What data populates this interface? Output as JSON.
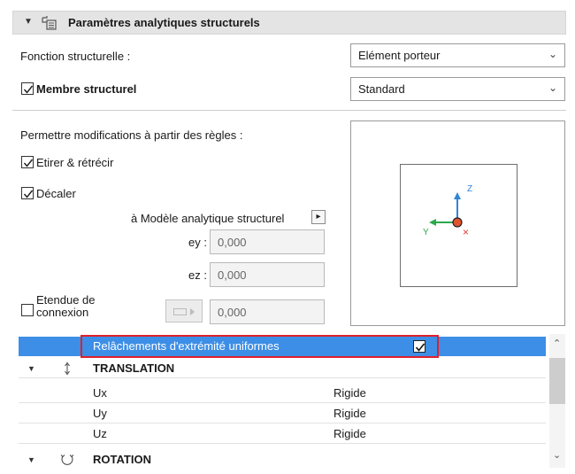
{
  "panel": {
    "title": "Paramètres analytiques structurels",
    "collapse_icon": "triangle-down",
    "icon": "panel-icon"
  },
  "structural_function": {
    "label": "Fonction structurelle :",
    "value": "Elément porteur"
  },
  "structural_member": {
    "label": "Membre structurel",
    "checked": true,
    "value": "Standard"
  },
  "rules": {
    "label": "Permettre modifications à partir des règles :",
    "stretch": {
      "label": "Etirer & rétrécir",
      "checked": true
    },
    "offset": {
      "label": "Décaler",
      "checked": true
    }
  },
  "analytical_model": {
    "label": "à Modèle analytique structurel",
    "arrow": "▸"
  },
  "ey": {
    "label": "ey :",
    "value": "0,000"
  },
  "ez": {
    "label": "ez :",
    "value": "0,000"
  },
  "connection_extent": {
    "label_line1": "Etendue de",
    "label_line2": "connexion",
    "checked": false,
    "value": "0,000"
  },
  "preview": {
    "z_label": "Z",
    "y_label": "Y",
    "x_label": "×"
  },
  "releases": {
    "uniform": {
      "label": "Relâchements d'extrémité uniformes",
      "checked": true
    },
    "translation": {
      "label": "TRANSLATION"
    },
    "rows": [
      {
        "name": "Ux",
        "value": "Rigide"
      },
      {
        "name": "Uy",
        "value": "Rigide"
      },
      {
        "name": "Uz",
        "value": "Rigide"
      }
    ],
    "rotation": {
      "label": "ROTATION"
    }
  },
  "colors": {
    "selection": "#3d8ee6",
    "highlight_border": "#e0202a",
    "z_axis": "#2f86d8",
    "y_axis": "#2aa84a",
    "x_axis": "#e23a2e"
  }
}
